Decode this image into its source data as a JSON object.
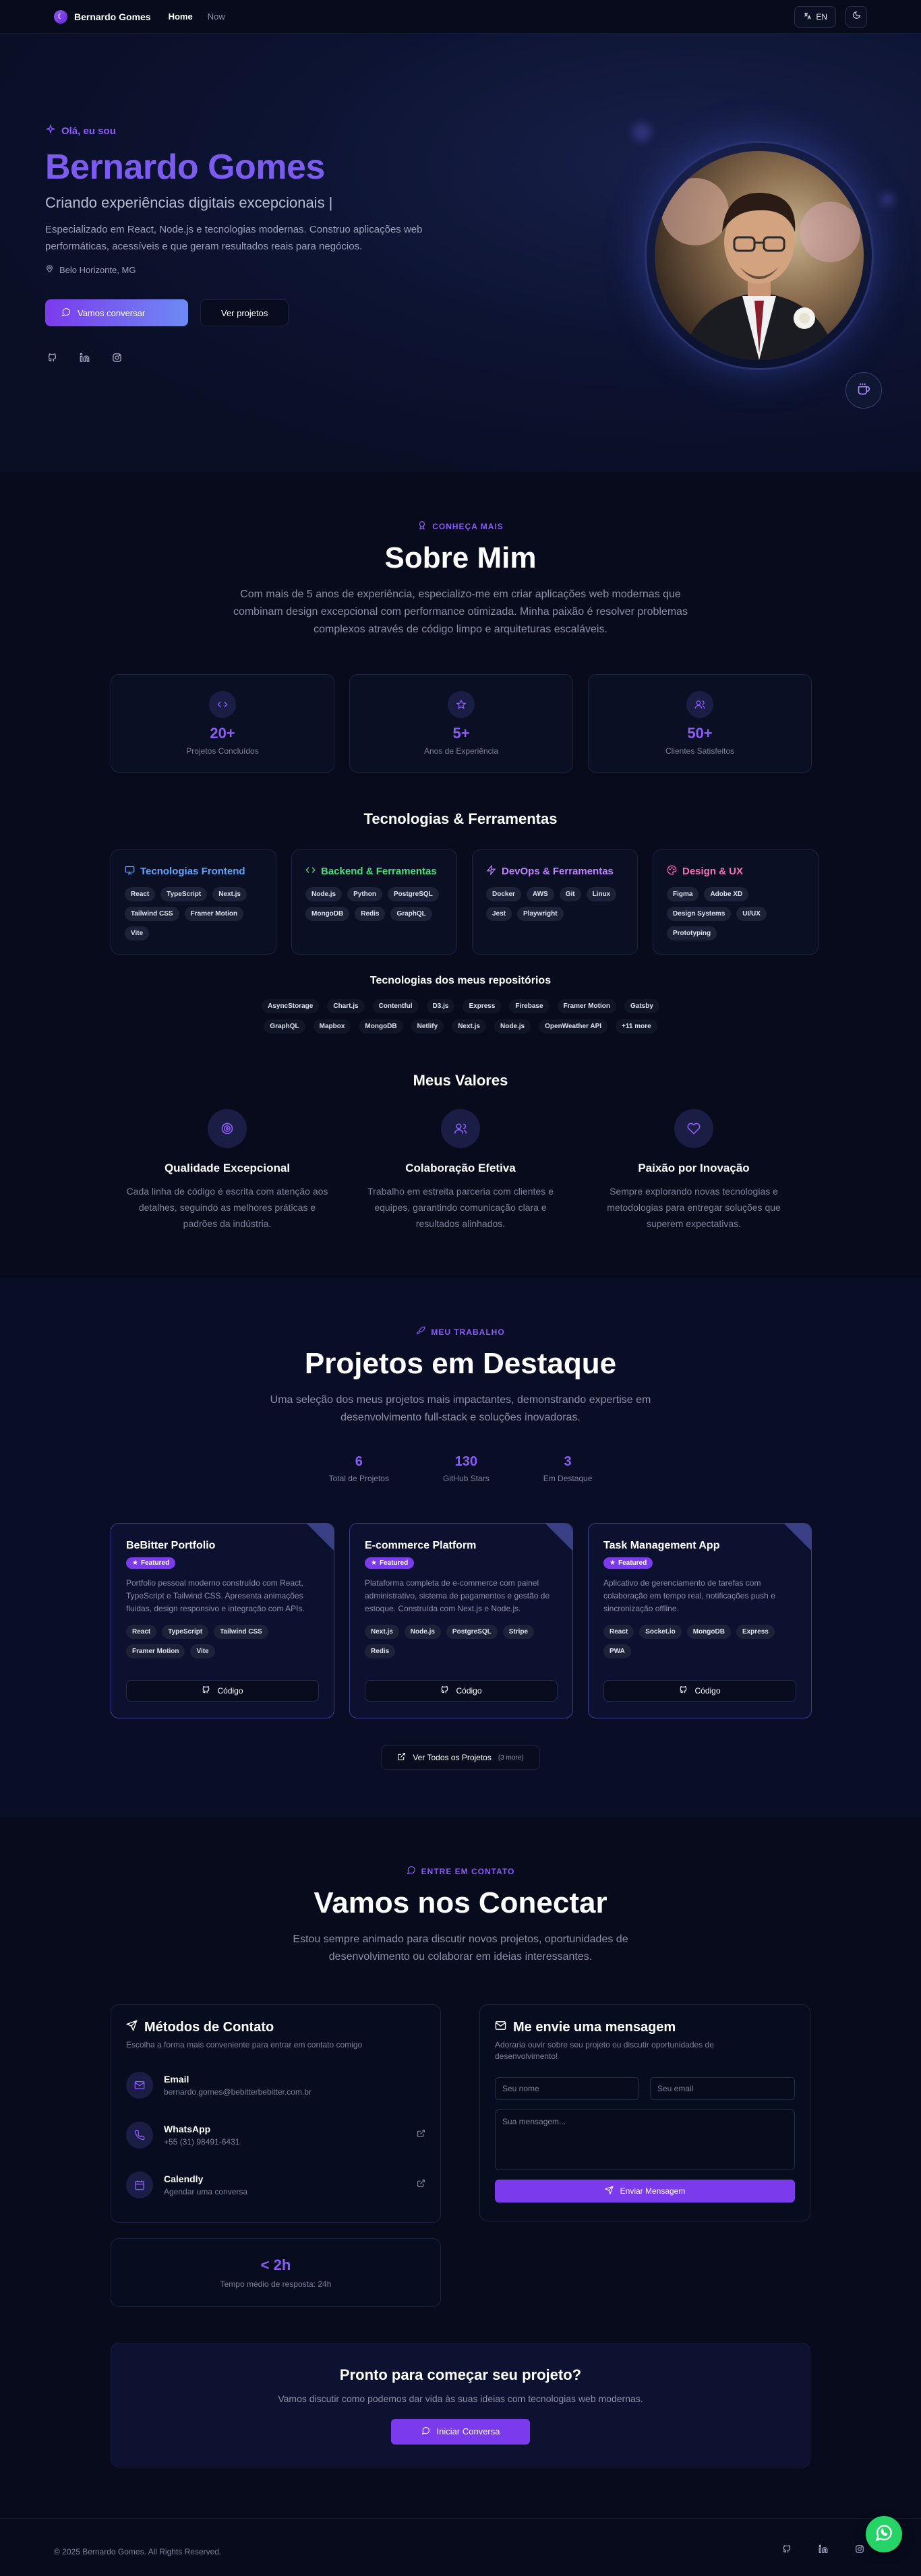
{
  "nav": {
    "brand": "Bernardo Gomes",
    "links": [
      {
        "label": "Home"
      },
      {
        "label": "Now"
      }
    ],
    "lang": "EN"
  },
  "hero": {
    "greeting": "Olá, eu sou",
    "name": "Bernardo Gomes",
    "tagline": "Criando experiências digitais excepcionais |",
    "description": "Especializado em React, Node.js e tecnologias modernas. Construo aplicações web performáticas, acessíveis e que geram resultados reais para negócios.",
    "location": "Belo Horizonte, MG",
    "cta_primary": "Vamos conversar",
    "cta_secondary": "Ver projetos"
  },
  "about": {
    "eyebrow": "CONHEÇA MAIS",
    "title": "Sobre Mim",
    "description": "Com mais de 5 anos de experiência, especializo-me em criar aplicações web modernas que combinam design excepcional com performance otimizada. Minha paixão é resolver problemas complexos através de código limpo e arquiteturas escaláveis.",
    "stats": [
      {
        "value": "20+",
        "label": "Projetos Concluídos"
      },
      {
        "value": "5+",
        "label": "Anos de Experiência"
      },
      {
        "value": "50+",
        "label": "Clientes Satisfeitos"
      }
    ],
    "tech_title": "Tecnologias & Ferramentas",
    "tech": [
      {
        "title": "Tecnologias Frontend",
        "color": "#60a5fa",
        "items": [
          "React",
          "TypeScript",
          "Next.js",
          "Tailwind CSS",
          "Framer Motion",
          "Vite"
        ]
      },
      {
        "title": "Backend & Ferramentas",
        "color": "#4ade80",
        "items": [
          "Node.js",
          "Python",
          "PostgreSQL",
          "MongoDB",
          "Redis",
          "GraphQL"
        ]
      },
      {
        "title": "DevOps & Ferramentas",
        "color": "#c084fc",
        "items": [
          "Docker",
          "AWS",
          "Git",
          "Linux",
          "Jest",
          "Playwright"
        ]
      },
      {
        "title": "Design & UX",
        "color": "#f472b6",
        "items": [
          "Figma",
          "Adobe XD",
          "Design Systems",
          "UI/UX",
          "Prototyping"
        ]
      }
    ],
    "repo_title": "Tecnologias dos meus repositórios",
    "repo_tech": [
      "AsyncStorage",
      "Chart.js",
      "Contentful",
      "D3.js",
      "Express",
      "Firebase",
      "Framer Motion",
      "Gatsby",
      "GraphQL",
      "Mapbox",
      "MongoDB",
      "Netlify",
      "Next.js",
      "Node.js",
      "OpenWeather API",
      "+11 more"
    ],
    "values_title": "Meus Valores",
    "values": [
      {
        "title": "Qualidade Excepcional",
        "desc": "Cada linha de código é escrita com atenção aos detalhes, seguindo as melhores práticas e padrões da indústria."
      },
      {
        "title": "Colaboração Efetiva",
        "desc": "Trabalho em estreita parceria com clientes e equipes, garantindo comunicação clara e resultados alinhados."
      },
      {
        "title": "Paixão por Inovação",
        "desc": "Sempre explorando novas tecnologias e metodologias para entregar soluções que superem expectativas."
      }
    ]
  },
  "projects": {
    "eyebrow": "MEU TRABALHO",
    "title": "Projetos em Destaque",
    "description": "Uma seleção dos meus projetos mais impactantes, demonstrando expertise em desenvolvimento full-stack e soluções inovadoras.",
    "stats": [
      {
        "value": "6",
        "label": "Total de Projetos"
      },
      {
        "value": "130",
        "label": "GitHub Stars"
      },
      {
        "value": "3",
        "label": "Em Destaque"
      }
    ],
    "featured_label": "Featured",
    "code_label": "Código",
    "items": [
      {
        "title": "BeBitter Portfolio",
        "desc": "Portfolio pessoal moderno construído com React, TypeScript e Tailwind CSS. Apresenta animações fluidas, design responsivo e integração com APIs.",
        "tags": [
          "React",
          "TypeScript",
          "Tailwind CSS",
          "Framer Motion",
          "Vite"
        ]
      },
      {
        "title": "E-commerce Platform",
        "desc": "Plataforma completa de e-commerce com painel administrativo, sistema de pagamentos e gestão de estoque. Construída com Next.js e Node.js.",
        "tags": [
          "Next.js",
          "Node.js",
          "PostgreSQL",
          "Stripe",
          "Redis"
        ]
      },
      {
        "title": "Task Management App",
        "desc": "Aplicativo de gerenciamento de tarefas com colaboração em tempo real, notificações push e sincronização offline.",
        "tags": [
          "React",
          "Socket.io",
          "MongoDB",
          "Express",
          "PWA"
        ]
      }
    ],
    "more_label": "Ver Todos os Projetos",
    "more_count": "(3 more)"
  },
  "contact": {
    "eyebrow": "ENTRE EM CONTATO",
    "title": "Vamos nos Conectar",
    "description": "Estou sempre animado para discutir novos projetos, oportunidades de desenvolvimento ou colaborar em ideias interessantes.",
    "methods_title": "Métodos de Contato",
    "methods_sub": "Escolha a forma mais conveniente para entrar em contato comigo",
    "methods": [
      {
        "title": "Email",
        "value": "bernardo.gomes@bebitterbebitter.com.br"
      },
      {
        "title": "WhatsApp",
        "value": "+55 (31) 98491-6431"
      },
      {
        "title": "Calendly",
        "value": "Agendar uma conversa"
      }
    ],
    "response_value": "< 2h",
    "response_label": "Tempo médio de resposta: 24h",
    "form_title": "Me envie uma mensagem",
    "form_sub": "Adoraria ouvir sobre seu projeto ou discutir oportunidades de desenvolvimento!",
    "name_ph": "Seu nome",
    "email_ph": "Seu email",
    "message_ph": "Sua mensagem...",
    "send_label": "Enviar Mensagem",
    "cta_title": "Pronto para começar seu projeto?",
    "cta_desc": "Vamos discutir como podemos dar vida às suas ideias com tecnologias web modernas.",
    "cta_button": "Iniciar Conversa"
  },
  "footer": {
    "copyright": "© 2025 Bernardo Gomes. All Rights Reserved."
  }
}
